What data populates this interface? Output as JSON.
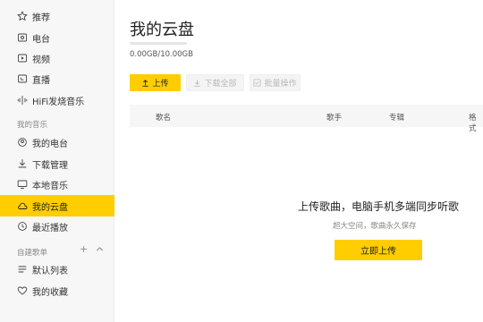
{
  "sidebar": {
    "top_items": [
      {
        "label": "推荐",
        "icon": "star-icon"
      },
      {
        "label": "电台",
        "icon": "radio-icon"
      },
      {
        "label": "视频",
        "icon": "video-icon"
      },
      {
        "label": "直播",
        "icon": "live-icon"
      },
      {
        "label": "HiFi发烧音乐",
        "icon": "hifi-icon"
      }
    ],
    "my_music_title": "我的音乐",
    "my_music_items": [
      {
        "label": "我的电台",
        "icon": "my-radio-icon"
      },
      {
        "label": "下载管理",
        "icon": "download-icon"
      },
      {
        "label": "本地音乐",
        "icon": "monitor-icon"
      },
      {
        "label": "我的云盘",
        "icon": "cloud-icon",
        "active": true
      },
      {
        "label": "最近播放",
        "icon": "clock-icon"
      }
    ],
    "playlist_title": "自建歌单",
    "playlist_add": "+",
    "playlist_collapse": "^",
    "playlist_items": [
      {
        "label": "默认列表",
        "icon": "list-icon"
      },
      {
        "label": "我的收藏",
        "icon": "heart-icon"
      }
    ],
    "active_color": "#ffcd00"
  },
  "main": {
    "title": "我的云盘",
    "quota_used_fraction": 0,
    "quota_text": "0.00GB/10.00GB",
    "toolbar": {
      "upload": "上传",
      "download_all": "下载全部",
      "batch": "批量操作"
    },
    "table_headers": {
      "song": "歌名",
      "artist": "歌手",
      "album": "专辑",
      "format": "格式"
    },
    "empty": {
      "title": "上传歌曲，电脑手机多端同步听歌",
      "subtitle": "超大空间，歌曲永久保存",
      "button": "立即上传"
    }
  }
}
